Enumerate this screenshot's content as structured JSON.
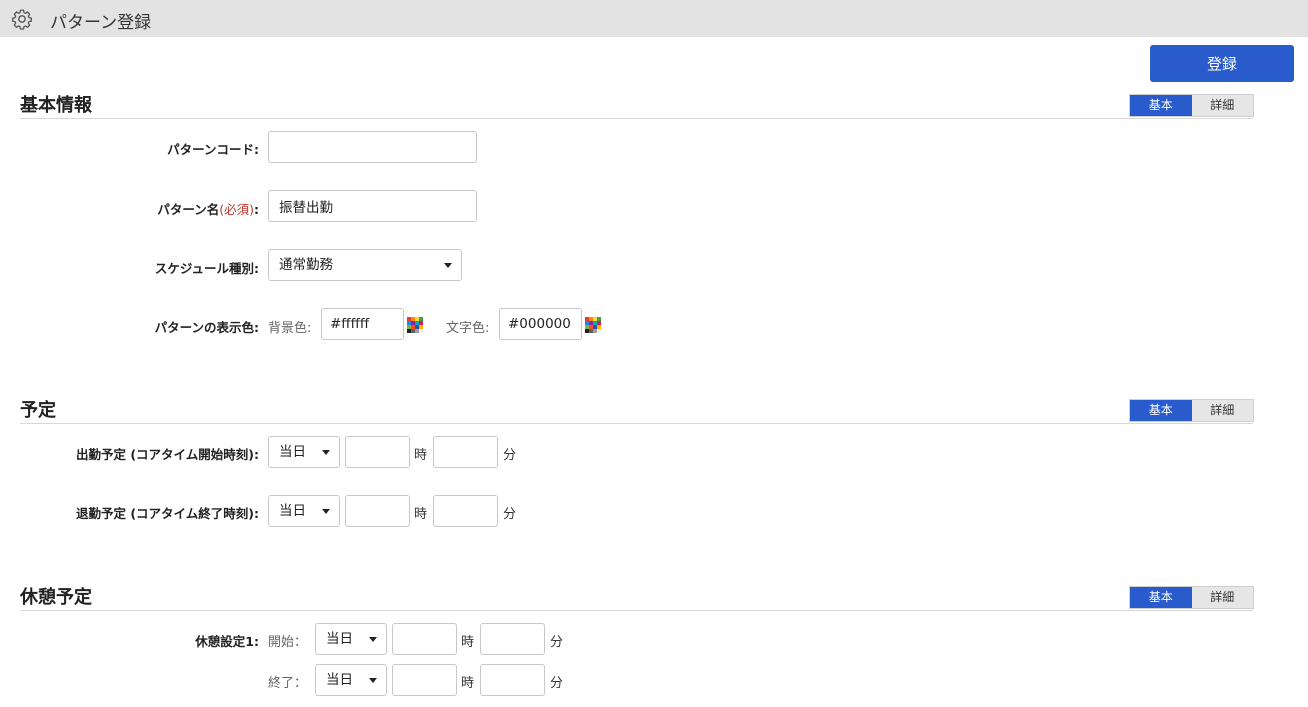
{
  "header": {
    "title": "パターン登録",
    "icon": "gear-icon"
  },
  "toolbar": {
    "register_label": "登録"
  },
  "toggle": {
    "basic": "基本",
    "detail": "詳細"
  },
  "basic_info": {
    "section_title": "基本情報",
    "pattern_code": {
      "label": "パターンコード:",
      "value": ""
    },
    "pattern_name": {
      "label": "パターン名",
      "required": "(必須)",
      "colon": ":",
      "value": "振替出勤"
    },
    "schedule_type": {
      "label": "スケジュール種別:",
      "value": "通常勤務"
    },
    "display_color": {
      "label": "パターンの表示色:",
      "bg_label": "背景色:",
      "bg_value": "#ffffff",
      "fg_label": "文字色:",
      "fg_value": "#000000"
    }
  },
  "schedule": {
    "section_title": "予定",
    "start": {
      "label": "出勤予定 (コアタイム開始時刻):",
      "day": "当日",
      "hour": "",
      "minute": ""
    },
    "end": {
      "label": "退勤予定 (コアタイム終了時刻):",
      "day": "当日",
      "hour": "",
      "minute": ""
    },
    "hour_unit": "時",
    "minute_unit": "分"
  },
  "break": {
    "section_title": "休憩予定",
    "setting1_label": "休憩設定1:",
    "start_label": "開始：",
    "end_label": "終了：",
    "start": {
      "day": "当日",
      "hour": "",
      "minute": ""
    },
    "end": {
      "day": "当日",
      "hour": "",
      "minute": ""
    }
  },
  "colors": {
    "accent": "#2a5bcc",
    "required": "#c0392b",
    "header_bg": "#e3e3e3"
  }
}
